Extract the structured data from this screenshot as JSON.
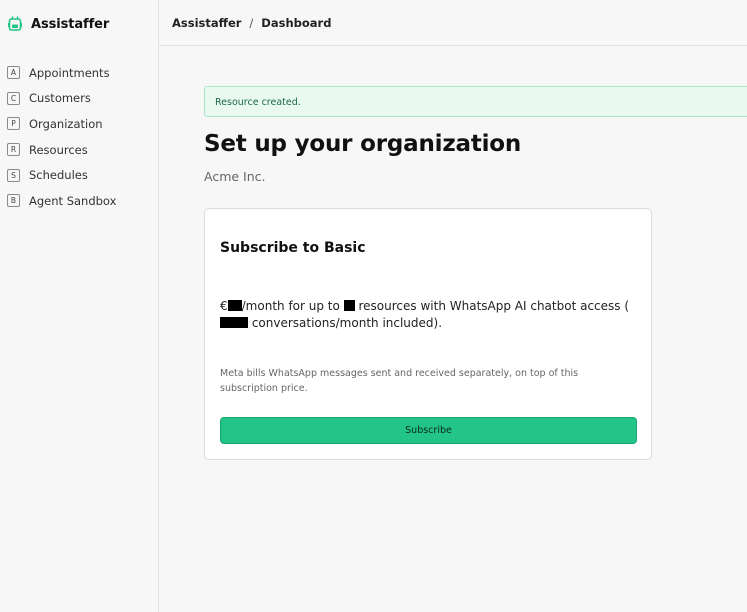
{
  "app": {
    "name": "Assistaffer",
    "logo_icon": "robot-icon",
    "accent_color": "#22c488"
  },
  "sidebar": {
    "items": [
      {
        "key": "A",
        "label": "Appointments"
      },
      {
        "key": "C",
        "label": "Customers"
      },
      {
        "key": "P",
        "label": "Organization"
      },
      {
        "key": "R",
        "label": "Resources"
      },
      {
        "key": "S",
        "label": "Schedules"
      },
      {
        "key": "B",
        "label": "Agent Sandbox"
      }
    ]
  },
  "breadcrumb": {
    "root": "Assistaffer",
    "separator": "/",
    "current": "Dashboard"
  },
  "alert": {
    "message": "Resource created."
  },
  "main": {
    "title": "Set up your organization",
    "org_name": "Acme Inc."
  },
  "plan_card": {
    "title": "Subscribe to Basic",
    "desc_prefix": "€",
    "desc_part2": "/month for up to",
    "desc_part3": "resources with WhatsApp AI chatbot access (",
    "desc_part4": "conversations/month included).",
    "note": "Meta bills WhatsApp messages sent and received separately, on top of this subscription price.",
    "subscribe_label": "Subscribe"
  }
}
